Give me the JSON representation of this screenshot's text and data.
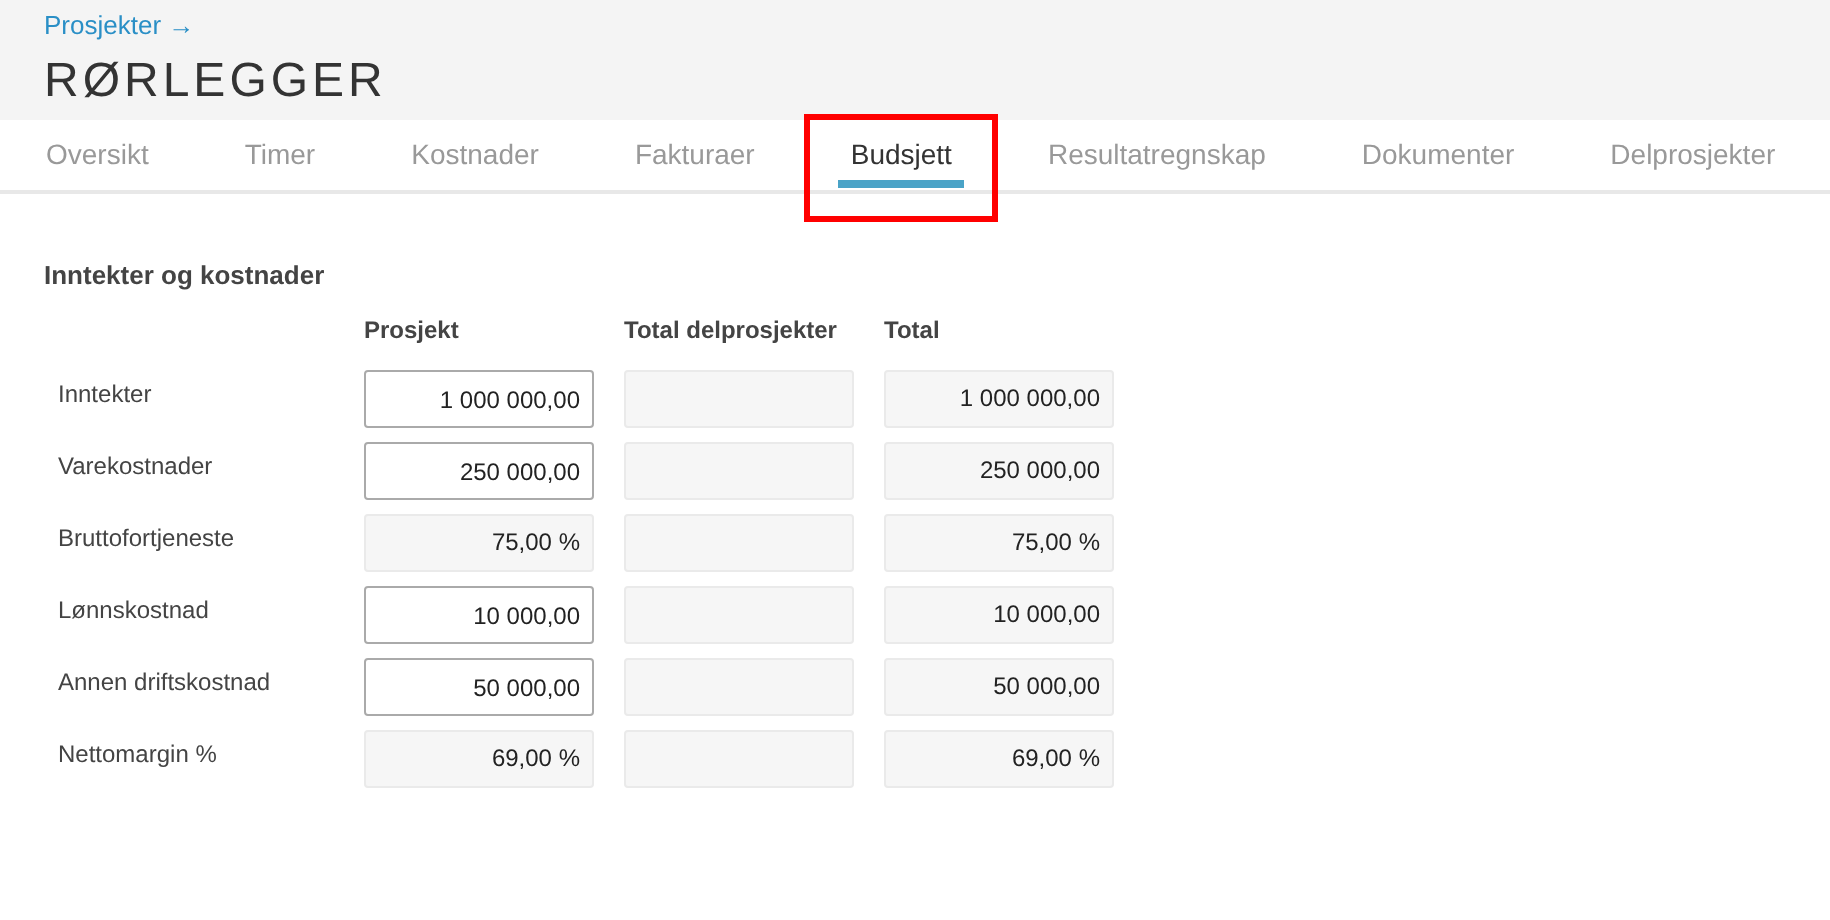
{
  "breadcrumb": "Prosjekter →",
  "title": "RØRLEGGER",
  "tabs": [
    {
      "label": "Oversikt",
      "selected": false,
      "highlighted": false
    },
    {
      "label": "Timer",
      "selected": false,
      "highlighted": false
    },
    {
      "label": "Kostnader",
      "selected": false,
      "highlighted": false
    },
    {
      "label": "Fakturaer",
      "selected": false,
      "highlighted": false
    },
    {
      "label": "Budsjett",
      "selected": true,
      "highlighted": true
    },
    {
      "label": "Resultatregnskap",
      "selected": false,
      "highlighted": false
    },
    {
      "label": "Dokumenter",
      "selected": false,
      "highlighted": false
    },
    {
      "label": "Delprosjekter",
      "selected": false,
      "highlighted": false
    }
  ],
  "section_title": "Inntekter og kostnader",
  "table": {
    "columns": [
      "Prosjekt",
      "Total delprosjekter",
      "Total"
    ],
    "rows": [
      {
        "label": "Inntekter",
        "cells": [
          {
            "kind": "input",
            "value": "1 000 000,00"
          },
          {
            "kind": "readonly"
          },
          {
            "kind": "readonly",
            "value": "1 000 000,00"
          }
        ]
      },
      {
        "label": "Varekostnader",
        "cells": [
          {
            "kind": "input",
            "value": "250 000,00"
          },
          {
            "kind": "readonly"
          },
          {
            "kind": "readonly",
            "value": "250 000,00"
          }
        ]
      },
      {
        "label": "Bruttofortjeneste",
        "cells": [
          {
            "kind": "readonly",
            "value": "75,00 %"
          },
          {
            "kind": "readonly"
          },
          {
            "kind": "readonly",
            "value": "75,00 %"
          }
        ]
      },
      {
        "label": "Lønnskostnad",
        "cells": [
          {
            "kind": "input",
            "value": "10 000,00"
          },
          {
            "kind": "readonly"
          },
          {
            "kind": "readonly",
            "value": "10 000,00"
          }
        ]
      },
      {
        "label": "Annen driftskostnad",
        "cells": [
          {
            "kind": "input",
            "value": "50 000,00"
          },
          {
            "kind": "readonly"
          },
          {
            "kind": "readonly",
            "value": "50 000,00"
          }
        ]
      },
      {
        "label": "Nettomargin %",
        "cells": [
          {
            "kind": "readonly",
            "value": "69,00 %"
          },
          {
            "kind": "readonly"
          },
          {
            "kind": "readonly",
            "value": "69,00 %"
          }
        ]
      }
    ]
  }
}
